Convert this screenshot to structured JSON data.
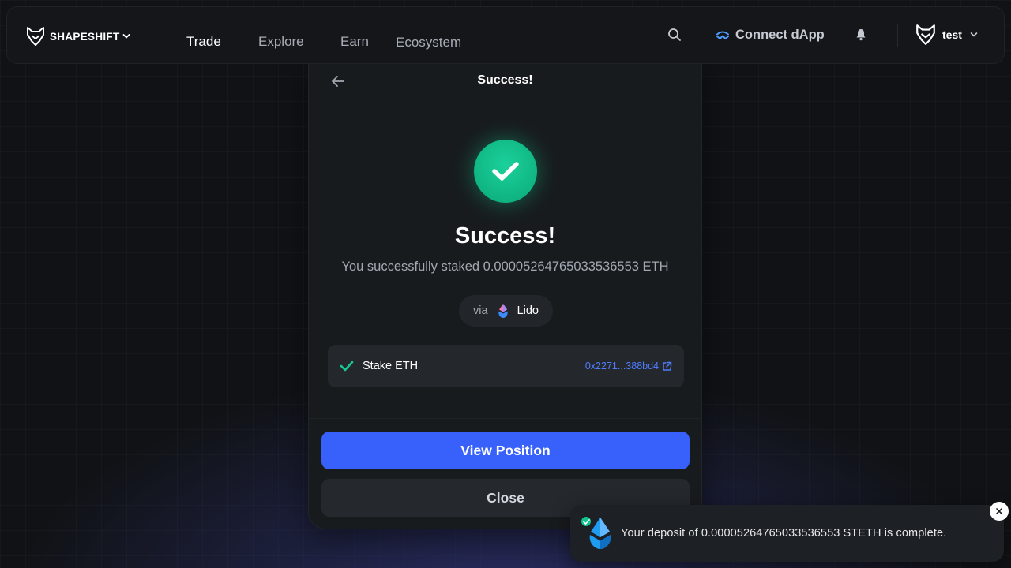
{
  "nav": {
    "brand": "SHAPESHIFT",
    "links": [
      "Trade",
      "Explore",
      "Earn",
      "Ecosystem"
    ],
    "active_link": "Trade",
    "connect_label": "Connect dApp",
    "user_name": "test",
    "icons": [
      "fox-logo",
      "chevron-down-icon",
      "search-icon",
      "walletconnect-icon",
      "bell-icon"
    ]
  },
  "modal": {
    "title": "Success!",
    "heading": "Success!",
    "message": "You successfully staked 0.00005264765033536553 ETH",
    "via_label": "via",
    "provider": "Lido",
    "tx_label": "Stake ETH",
    "tx_hash": "0x2271...388bd4",
    "primary_button": "View Position",
    "secondary_button": "Close"
  },
  "toast": {
    "message": "Your deposit of 0.00005264765033536553 STETH is complete."
  },
  "colors": {
    "accent": "#3861fb",
    "success": "#10c48d",
    "link": "#4f7dff"
  }
}
